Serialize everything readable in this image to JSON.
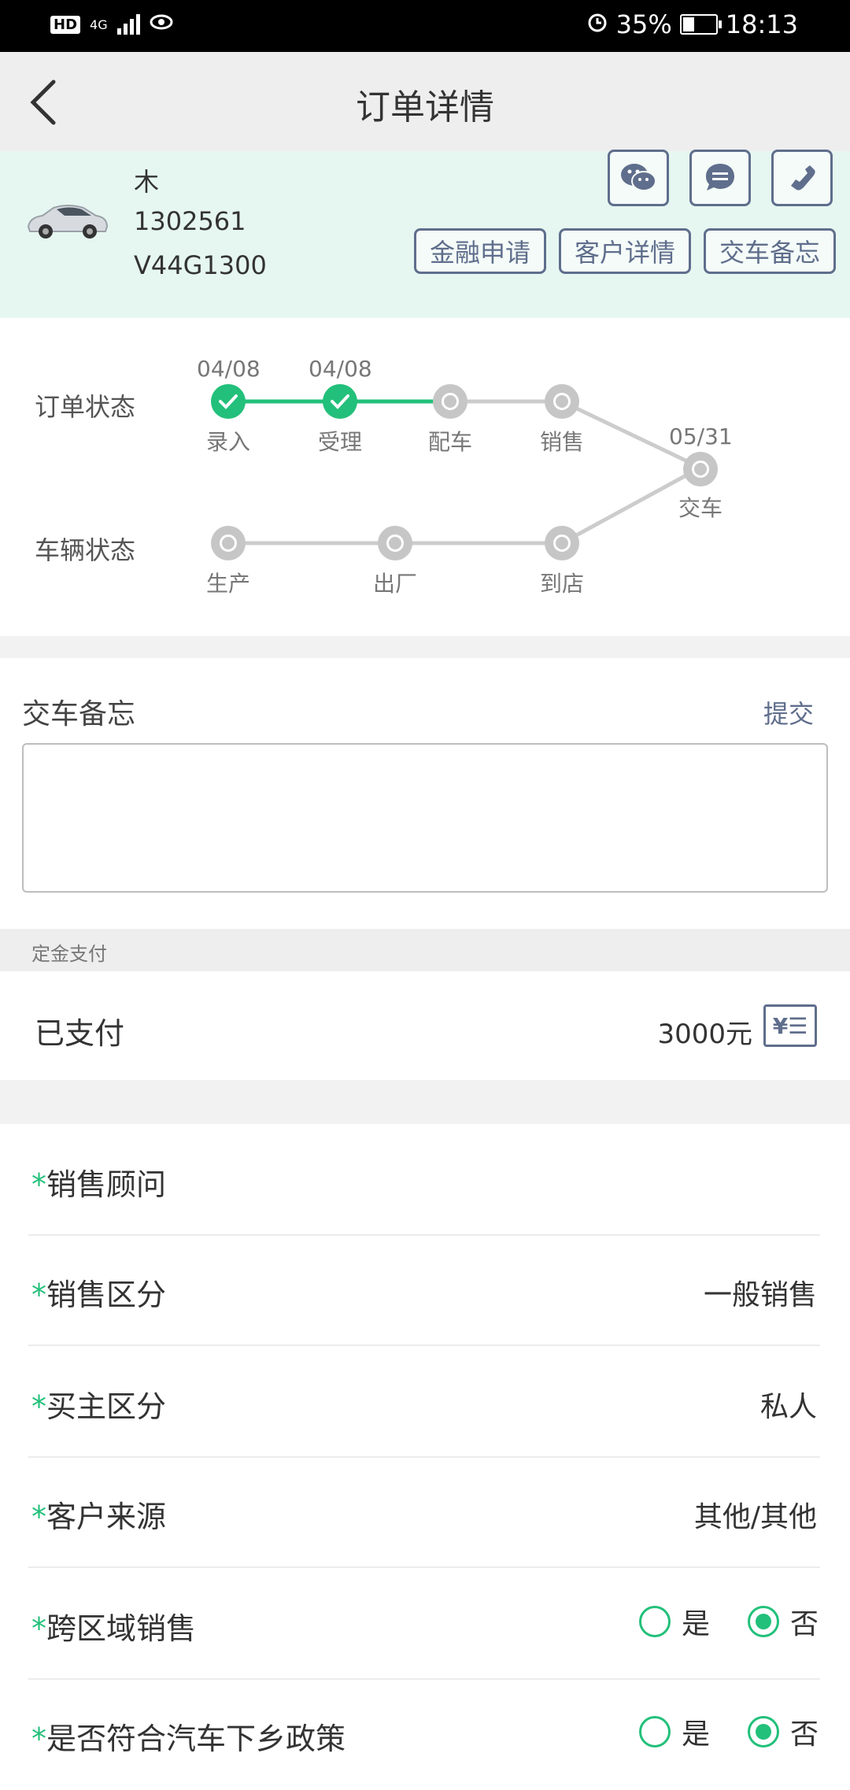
{
  "status_bar": {
    "network": "4G",
    "battery": "35%",
    "time": "18:13",
    "hd_badge": "HD"
  },
  "header": {
    "title": "订单详情"
  },
  "car": {
    "name": "木",
    "phone": "1302561",
    "vin": "V44G1300"
  },
  "actions": {
    "finance": "金融申请",
    "customer": "客户详情",
    "memo": "交车备忘"
  },
  "order_status": {
    "label": "订单状态",
    "steps": [
      {
        "name": "录入",
        "date": "04/08",
        "done": true
      },
      {
        "name": "受理",
        "date": "04/08",
        "done": true
      },
      {
        "name": "配车",
        "date": "",
        "done": false
      },
      {
        "name": "销售",
        "date": "",
        "done": false
      }
    ]
  },
  "delivery": {
    "name": "交车",
    "date": "05/31"
  },
  "vehicle_status": {
    "label": "车辆状态",
    "steps": [
      {
        "name": "生产"
      },
      {
        "name": "出厂"
      },
      {
        "name": "到店"
      }
    ]
  },
  "memo_section": {
    "title": "交车备忘",
    "submit": "提交",
    "value": ""
  },
  "deposit": {
    "header": "定金支付",
    "paid_label": "已支付",
    "amount": "3000元",
    "pay_icon": "¥☰"
  },
  "fields": [
    {
      "req": "*",
      "label": "销售顾问",
      "value": ""
    },
    {
      "req": "*",
      "label": "销售区分",
      "value": "一般销售"
    },
    {
      "req": "*",
      "label": "买主区分",
      "value": "私人"
    },
    {
      "req": "*",
      "label": "客户来源",
      "value": "其他/其他"
    }
  ],
  "radio_fields": [
    {
      "req": "*",
      "label": "跨区域销售",
      "yes": "是",
      "no": "否",
      "selected": "no"
    },
    {
      "req": "*",
      "label": "是否符合汽车下乡政策",
      "yes": "是",
      "no": "否",
      "selected": "no"
    }
  ]
}
